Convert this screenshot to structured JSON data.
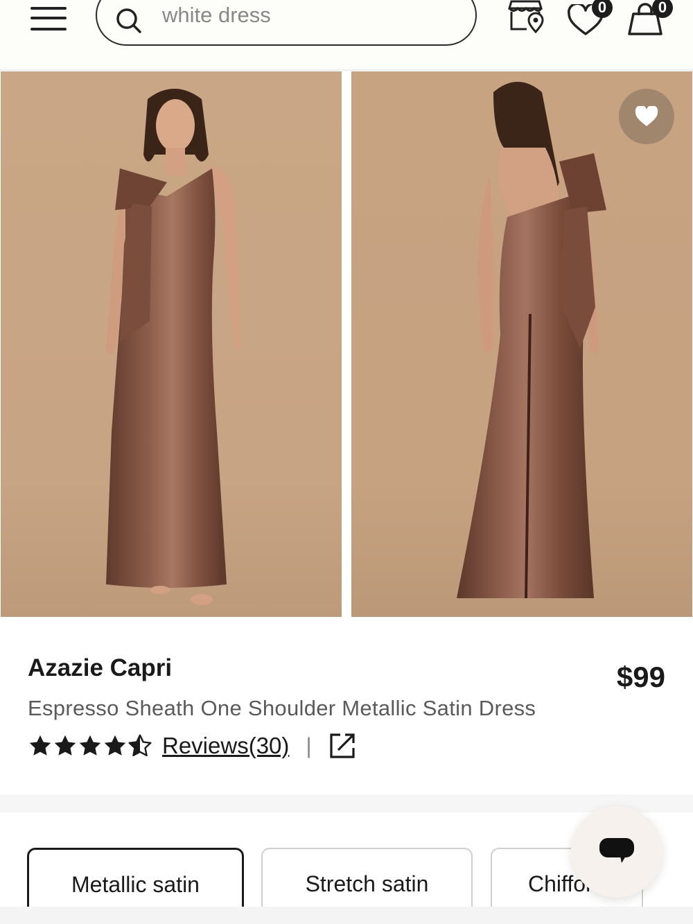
{
  "header": {
    "search": {
      "value": "",
      "placeholder": "white dress"
    },
    "wishlist_count": "0",
    "cart_count": "0",
    "icons": [
      "menu-icon",
      "search-icon",
      "store-locator-icon",
      "heart-icon",
      "shopping-bag-icon"
    ]
  },
  "product": {
    "brand": "Azazie Capri",
    "name": "Espresso Sheath One Shoulder Metallic Satin Dress",
    "price": "$99",
    "rating": 4.5,
    "reviews_label": "Reviews(30)",
    "separator": "|"
  },
  "fabrics": [
    {
      "label": "Metallic satin",
      "selected": true
    },
    {
      "label": "Stretch satin",
      "selected": false
    },
    {
      "label": "Chiffon",
      "selected": false
    }
  ],
  "colors": {
    "photo_background": "#c8a584",
    "dress": "#7a4f3f",
    "wish_button": "#96826f",
    "text": "#1a1a1a"
  }
}
